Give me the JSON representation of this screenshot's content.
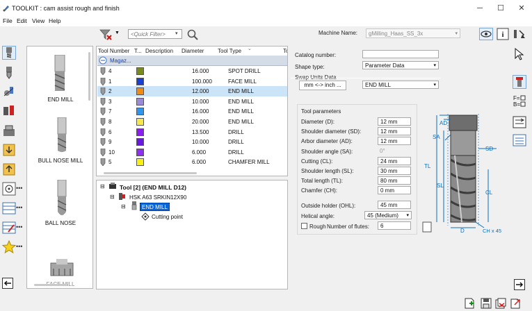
{
  "title": "TOOLKIT : cam assist rough and finish",
  "menu": [
    "File",
    "Edit",
    "View",
    "Help"
  ],
  "toolbar": {
    "quick_filter_placeholder": "<Quick Filter>",
    "machine_label": "Machine Name:",
    "machine_value": "gMilling_Haas_SS_3x"
  },
  "library": [
    "END MILL",
    "BULL NOSE MILL",
    "BALL NOSE",
    "FACE MILL"
  ],
  "grid": {
    "headers": [
      "Tool Number",
      "T...",
      "Description",
      "Diameter",
      "Tool Type",
      "To"
    ],
    "group_row": "Magaz...",
    "rows": [
      {
        "num": "4",
        "color": "#7a8a1c",
        "diameter": "16.000",
        "type": "SPOT DRILL"
      },
      {
        "num": "1",
        "color": "#1a3fd6",
        "diameter": "100.000",
        "type": "FACE MILL"
      },
      {
        "num": "2",
        "color": "#f08a10",
        "diameter": "12.000",
        "type": "END MILL"
      },
      {
        "num": "3",
        "color": "#9a8ad8",
        "diameter": "10.000",
        "type": "END MILL"
      },
      {
        "num": "7",
        "color": "#2f96f0",
        "diameter": "16.000",
        "type": "END MILL"
      },
      {
        "num": "8",
        "color": "#f6e84a",
        "diameter": "20.000",
        "type": "END MILL"
      },
      {
        "num": "6",
        "color": "#8a1df0",
        "diameter": "13.500",
        "type": "DRILL"
      },
      {
        "num": "9",
        "color": "#6a1ae0",
        "diameter": "10.000",
        "type": "DRILL"
      },
      {
        "num": "10",
        "color": "#8f2ff5",
        "diameter": "6.000",
        "type": "DRILL"
      },
      {
        "num": "5",
        "color": "#f8f010",
        "diameter": "6.000",
        "type": "CHAMFER MILL"
      }
    ],
    "selected_index": 2
  },
  "tree": {
    "root": "Tool [2] (END MILL D12)",
    "holder": "HSK A63 SRKIN12X90",
    "cutter": "END MILL",
    "point": "Cutting point"
  },
  "props": {
    "catalog_label": "Catalog number:",
    "catalog_value": "",
    "shape_label": "Shape type:",
    "shape_value": "Parameter Data",
    "swap_label": "Swap Units Data",
    "swap_button": "mm <-> inch ...",
    "type_value": "END MILL",
    "params_title": "Tool parameters",
    "params": [
      {
        "label": "Diameter (D):",
        "value": "12 mm"
      },
      {
        "label": "Shoulder diameter (SD):",
        "value": "12 mm"
      },
      {
        "label": "Arbor diameter (AD):",
        "value": "12 mm"
      },
      {
        "label": "Shoulder angle (SA):",
        "value": "0°"
      },
      {
        "label": "Cutting (CL):",
        "value": "24 mm"
      },
      {
        "label": "Shoulder length (SL):",
        "value": "30 mm"
      },
      {
        "label": "Total length (TL):",
        "value": "80 mm"
      },
      {
        "label": "Chamfer (CH):",
        "value": "0 mm"
      }
    ],
    "outside_holder_label": "Outside holder (OHL):",
    "outside_holder_value": "45 mm",
    "helical_label": "Helical angle:",
    "helical_value": "45 (Medium)",
    "rough_label": "Rough",
    "flutes_label": "Number of flutes:",
    "flutes_value": "6"
  },
  "diagram_labels": {
    "ad": "AD",
    "sa": "SA",
    "sd": "SD",
    "tl": "TL",
    "sl": "SL",
    "cl": "CL",
    "d": "D",
    "ch": "CH x 45"
  }
}
